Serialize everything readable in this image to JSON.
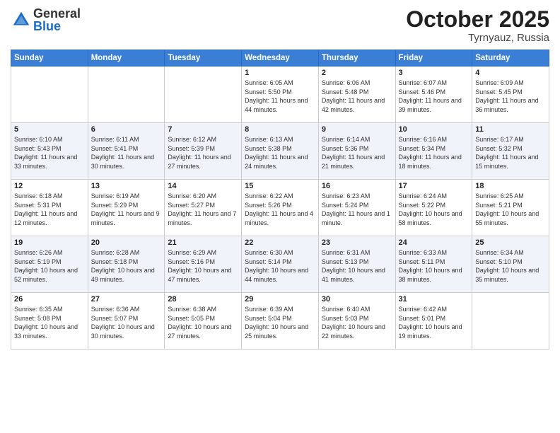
{
  "header": {
    "logo_general": "General",
    "logo_blue": "Blue",
    "month": "October 2025",
    "location": "Tyrnyauz, Russia"
  },
  "days_of_week": [
    "Sunday",
    "Monday",
    "Tuesday",
    "Wednesday",
    "Thursday",
    "Friday",
    "Saturday"
  ],
  "weeks": [
    [
      {
        "day": "",
        "info": ""
      },
      {
        "day": "",
        "info": ""
      },
      {
        "day": "",
        "info": ""
      },
      {
        "day": "1",
        "info": "Sunrise: 6:05 AM\nSunset: 5:50 PM\nDaylight: 11 hours and 44 minutes."
      },
      {
        "day": "2",
        "info": "Sunrise: 6:06 AM\nSunset: 5:48 PM\nDaylight: 11 hours and 42 minutes."
      },
      {
        "day": "3",
        "info": "Sunrise: 6:07 AM\nSunset: 5:46 PM\nDaylight: 11 hours and 39 minutes."
      },
      {
        "day": "4",
        "info": "Sunrise: 6:09 AM\nSunset: 5:45 PM\nDaylight: 11 hours and 36 minutes."
      }
    ],
    [
      {
        "day": "5",
        "info": "Sunrise: 6:10 AM\nSunset: 5:43 PM\nDaylight: 11 hours and 33 minutes."
      },
      {
        "day": "6",
        "info": "Sunrise: 6:11 AM\nSunset: 5:41 PM\nDaylight: 11 hours and 30 minutes."
      },
      {
        "day": "7",
        "info": "Sunrise: 6:12 AM\nSunset: 5:39 PM\nDaylight: 11 hours and 27 minutes."
      },
      {
        "day": "8",
        "info": "Sunrise: 6:13 AM\nSunset: 5:38 PM\nDaylight: 11 hours and 24 minutes."
      },
      {
        "day": "9",
        "info": "Sunrise: 6:14 AM\nSunset: 5:36 PM\nDaylight: 11 hours and 21 minutes."
      },
      {
        "day": "10",
        "info": "Sunrise: 6:16 AM\nSunset: 5:34 PM\nDaylight: 11 hours and 18 minutes."
      },
      {
        "day": "11",
        "info": "Sunrise: 6:17 AM\nSunset: 5:32 PM\nDaylight: 11 hours and 15 minutes."
      }
    ],
    [
      {
        "day": "12",
        "info": "Sunrise: 6:18 AM\nSunset: 5:31 PM\nDaylight: 11 hours and 12 minutes."
      },
      {
        "day": "13",
        "info": "Sunrise: 6:19 AM\nSunset: 5:29 PM\nDaylight: 11 hours and 9 minutes."
      },
      {
        "day": "14",
        "info": "Sunrise: 6:20 AM\nSunset: 5:27 PM\nDaylight: 11 hours and 7 minutes."
      },
      {
        "day": "15",
        "info": "Sunrise: 6:22 AM\nSunset: 5:26 PM\nDaylight: 11 hours and 4 minutes."
      },
      {
        "day": "16",
        "info": "Sunrise: 6:23 AM\nSunset: 5:24 PM\nDaylight: 11 hours and 1 minute."
      },
      {
        "day": "17",
        "info": "Sunrise: 6:24 AM\nSunset: 5:22 PM\nDaylight: 10 hours and 58 minutes."
      },
      {
        "day": "18",
        "info": "Sunrise: 6:25 AM\nSunset: 5:21 PM\nDaylight: 10 hours and 55 minutes."
      }
    ],
    [
      {
        "day": "19",
        "info": "Sunrise: 6:26 AM\nSunset: 5:19 PM\nDaylight: 10 hours and 52 minutes."
      },
      {
        "day": "20",
        "info": "Sunrise: 6:28 AM\nSunset: 5:18 PM\nDaylight: 10 hours and 49 minutes."
      },
      {
        "day": "21",
        "info": "Sunrise: 6:29 AM\nSunset: 5:16 PM\nDaylight: 10 hours and 47 minutes."
      },
      {
        "day": "22",
        "info": "Sunrise: 6:30 AM\nSunset: 5:14 PM\nDaylight: 10 hours and 44 minutes."
      },
      {
        "day": "23",
        "info": "Sunrise: 6:31 AM\nSunset: 5:13 PM\nDaylight: 10 hours and 41 minutes."
      },
      {
        "day": "24",
        "info": "Sunrise: 6:33 AM\nSunset: 5:11 PM\nDaylight: 10 hours and 38 minutes."
      },
      {
        "day": "25",
        "info": "Sunrise: 6:34 AM\nSunset: 5:10 PM\nDaylight: 10 hours and 35 minutes."
      }
    ],
    [
      {
        "day": "26",
        "info": "Sunrise: 6:35 AM\nSunset: 5:08 PM\nDaylight: 10 hours and 33 minutes."
      },
      {
        "day": "27",
        "info": "Sunrise: 6:36 AM\nSunset: 5:07 PM\nDaylight: 10 hours and 30 minutes."
      },
      {
        "day": "28",
        "info": "Sunrise: 6:38 AM\nSunset: 5:05 PM\nDaylight: 10 hours and 27 minutes."
      },
      {
        "day": "29",
        "info": "Sunrise: 6:39 AM\nSunset: 5:04 PM\nDaylight: 10 hours and 25 minutes."
      },
      {
        "day": "30",
        "info": "Sunrise: 6:40 AM\nSunset: 5:03 PM\nDaylight: 10 hours and 22 minutes."
      },
      {
        "day": "31",
        "info": "Sunrise: 6:42 AM\nSunset: 5:01 PM\nDaylight: 10 hours and 19 minutes."
      },
      {
        "day": "",
        "info": ""
      }
    ]
  ]
}
